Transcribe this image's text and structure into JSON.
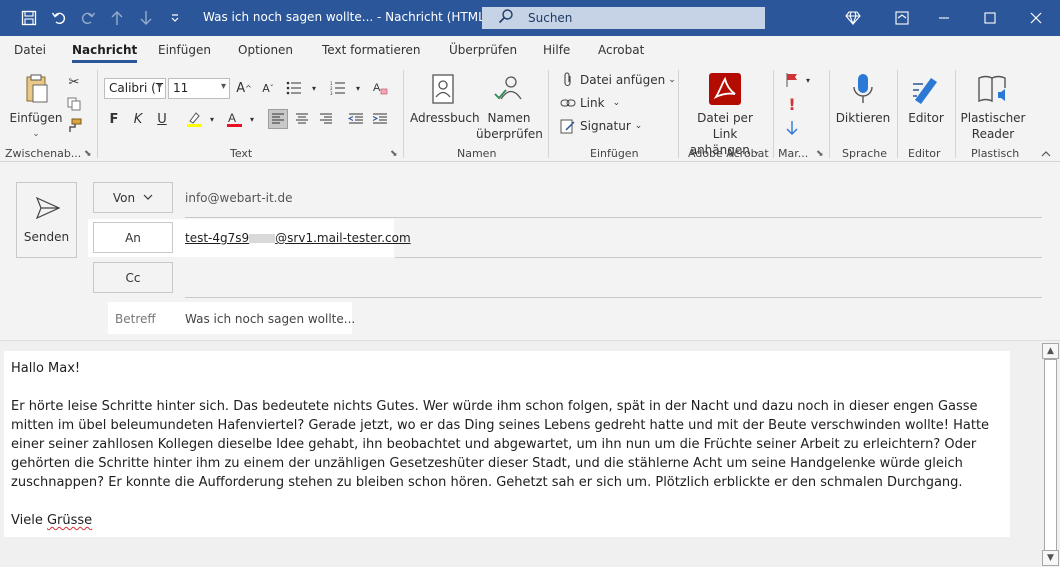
{
  "window": {
    "title": "Was ich noch sagen wollte...  -  Nachricht (HTML)",
    "search_placeholder": "Suchen"
  },
  "tabs": [
    {
      "label": "Datei"
    },
    {
      "label": "Nachricht",
      "active": true
    },
    {
      "label": "Einfügen"
    },
    {
      "label": "Optionen"
    },
    {
      "label": "Text formatieren"
    },
    {
      "label": "Überprüfen"
    },
    {
      "label": "Hilfe"
    },
    {
      "label": "Acrobat"
    }
  ],
  "ribbon": {
    "clipboard": {
      "paste_label": "Einfügen",
      "group_label": "Zwischenab..."
    },
    "text": {
      "font_name": "Calibri (T",
      "font_size": "11",
      "bold": "F",
      "italic": "K",
      "underline": "U",
      "group_label": "Text"
    },
    "names": {
      "address_book_label": "Adressbuch",
      "check_names_line1": "Namen",
      "check_names_line2": "überprüfen",
      "group_label": "Namen"
    },
    "insert": {
      "attach_label": "Datei anfügen",
      "link_label": "Link",
      "signature_label": "Signatur",
      "group_label": "Einfügen"
    },
    "acrobat": {
      "attach_link_line1": "Datei per Link",
      "attach_link_line2": "anhängen",
      "group_label": "Adobe Acrobat"
    },
    "tags": {
      "group_label": "Mar..."
    },
    "voice": {
      "dictate_label": "Diktieren",
      "group_label": "Sprache"
    },
    "editor": {
      "editor_label": "Editor",
      "group_label": "Editor"
    },
    "immersive": {
      "line1": "Plastischer",
      "line2": "Reader",
      "group_label": "Plastisch"
    }
  },
  "compose": {
    "send_label": "Senden",
    "from_label": "Von",
    "from_value": "info@webart-it.de",
    "to_label": "An",
    "to_value_prefix": "test-4g7s9",
    "to_value_suffix": "@srv1.mail-tester.com",
    "cc_label": "Cc",
    "cc_value": "",
    "subject_label": "Betreff",
    "subject_value": "Was ich noch sagen wollte..."
  },
  "body": {
    "greeting": "Hallo Max!",
    "paragraph": "Er hörte leise Schritte hinter sich. Das bedeutete nichts Gutes. Wer würde ihm schon folgen, spät in der Nacht und dazu noch in dieser engen Gasse mitten im übel beleumundeten Hafenviertel? Gerade jetzt, wo er das Ding seines Lebens gedreht hatte und mit der Beute verschwinden wollte! Hatte einer seiner zahllosen Kollegen dieselbe Idee gehabt, ihn beobachtet und abgewartet, um ihn nun um die Früchte seiner Arbeit zu erleichtern? Oder gehörten die Schritte hinter ihm zu einem der unzähligen Gesetzeshüter dieser Stadt, und die stählerne Acht um seine Handgelenke würde gleich zuschnappen? Er konnte die Aufforderung stehen zu bleiben schon hören. Gehetzt sah er sich um. Plötzlich erblickte er den schmalen Durchgang.",
    "closing_word": "Viele",
    "closing_misspelled": "Grüsse"
  },
  "colors": {
    "titlebar": "#2b579a",
    "acrobat_red": "#b30b00",
    "accent_blue": "#2b579a"
  }
}
